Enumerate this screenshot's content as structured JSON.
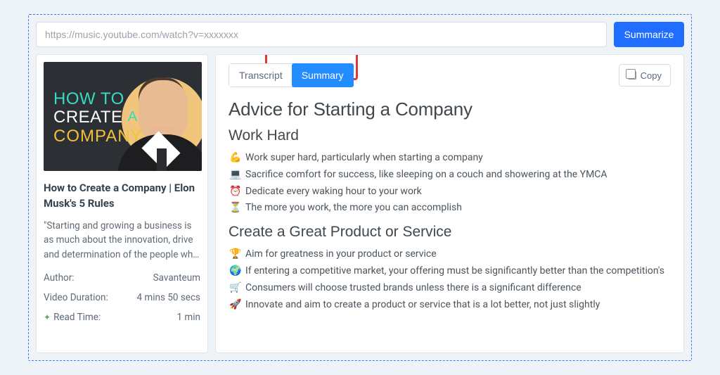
{
  "url_placeholder": "https://music.youtube.com/watch?v=xxxxxxx",
  "summarize_label": "Summarize",
  "thumbnail": {
    "line1_a": "HOW",
    "line1_b": "TO",
    "line2_a": "CREATE",
    "line2_b": "A",
    "line3": "COMPANY"
  },
  "video": {
    "title": "How to Create a Company | Elon Musk's 5 Rules",
    "description": "\"Starting and growing a business is as much about the innovation, drive and determination of the people who do it...",
    "author_label": "Author:",
    "author_value": "Savanteum",
    "duration_label": "Video Duration:",
    "duration_value": "4 mins 50 secs",
    "readtime_label": "Read Time:",
    "readtime_value": "1 min"
  },
  "tabs": {
    "transcript": "Transcript",
    "summary": "Summary"
  },
  "copy_label": "Copy",
  "summary": {
    "title": "Advice for Starting a Company",
    "sections": [
      {
        "heading": "Work Hard",
        "items": [
          {
            "emoji": "💪",
            "text": "Work super hard, particularly when starting a company"
          },
          {
            "emoji": "💻",
            "text": "Sacrifice comfort for success, like sleeping on a couch and showering at the YMCA"
          },
          {
            "emoji": "⏰",
            "text": "Dedicate every waking hour to your work"
          },
          {
            "emoji": "⏳",
            "text": "The more you work, the more you can accomplish"
          }
        ]
      },
      {
        "heading": "Create a Great Product or Service",
        "items": [
          {
            "emoji": "🏆",
            "text": "Aim for greatness in your product or service"
          },
          {
            "emoji": "🌍",
            "text": "If entering a competitive market, your offering must be significantly better than the competition's"
          },
          {
            "emoji": "🛒",
            "text": "Consumers will choose trusted brands unless there is a significant difference"
          },
          {
            "emoji": "🚀",
            "text": "Innovate and aim to create a product or service that is a lot better, not just slightly"
          }
        ]
      }
    ]
  }
}
